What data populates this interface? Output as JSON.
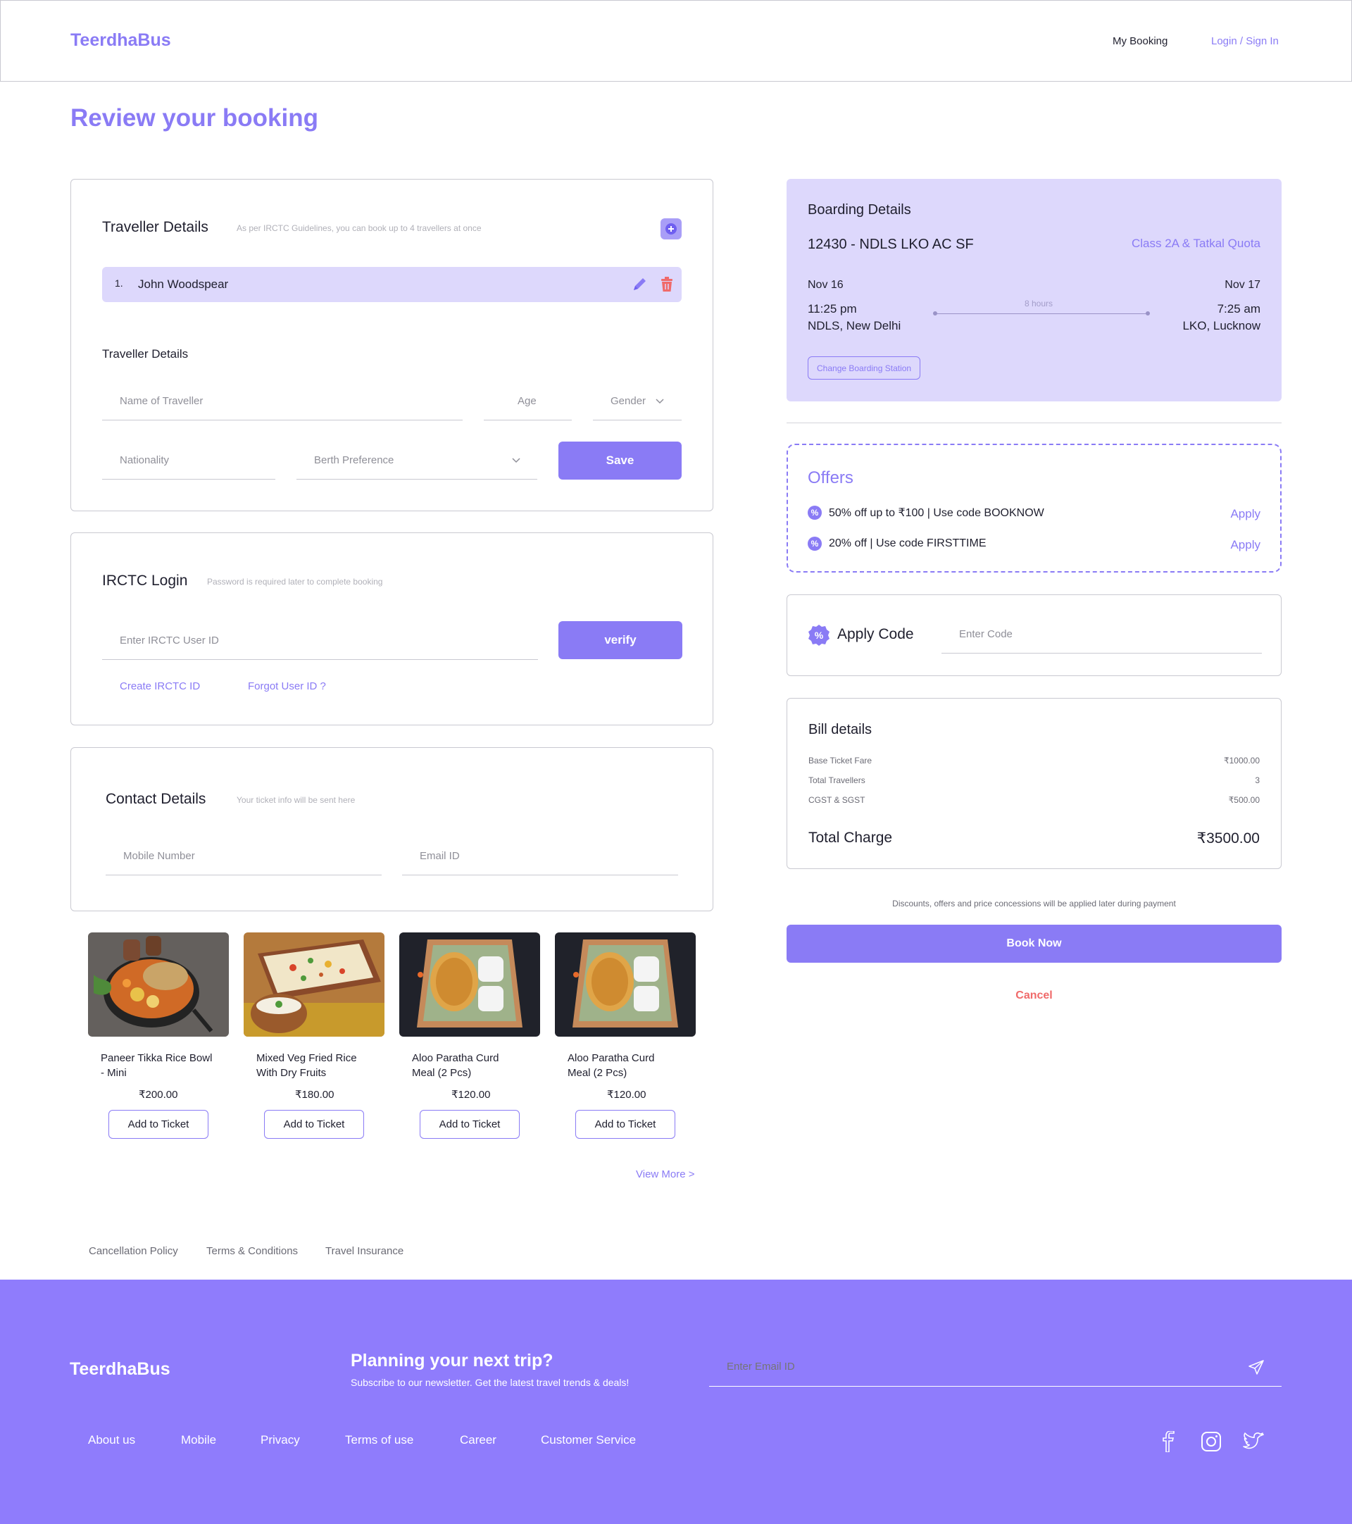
{
  "header": {
    "logo": "TeerdhaBus",
    "my_booking": "My Booking",
    "login": "Login / Sign In"
  },
  "page_title": "Review your booking",
  "traveller": {
    "title": "Traveller Details",
    "hint": "As per IRCTC Guidelines, you can book up to 4 travellers at once",
    "list": [
      {
        "index": "1.",
        "name": "John Woodspear"
      }
    ],
    "form_title": "Traveller Details",
    "name_placeholder": "Name of Traveller",
    "age_placeholder": "Age",
    "gender_label": "Gender",
    "nationality_placeholder": "Nationality",
    "berth_label": "Berth Preference",
    "save_label": "Save"
  },
  "irctc": {
    "title": "IRCTC Login",
    "hint": "Password is required later to complete booking",
    "userid_placeholder": "Enter IRCTC User ID",
    "verify_label": "verify",
    "create_label": "Create IRCTC ID",
    "forgot_label": "Forgot User ID ?"
  },
  "contact": {
    "title": "Contact Details",
    "hint": "Your ticket info will be sent here",
    "mobile_placeholder": "Mobile Number",
    "email_placeholder": "Email ID"
  },
  "food": {
    "items": [
      {
        "name": "Paneer Tikka Rice Bowl - Mini",
        "price": "₹200.00",
        "button": "Add to Ticket"
      },
      {
        "name": "Mixed Veg Fried Rice With Dry Fruits",
        "price": "₹180.00",
        "button": "Add to Ticket"
      },
      {
        "name": "Aloo Paratha Curd Meal (2 Pcs)",
        "price": "₹120.00",
        "button": "Add to Ticket"
      },
      {
        "name": "Aloo Paratha Curd Meal (2 Pcs)",
        "price": "₹120.00",
        "button": "Add to Ticket"
      }
    ],
    "view_more": "View More >"
  },
  "policy_links": [
    "Cancellation Policy",
    "Terms & Conditions",
    "Travel Insurance"
  ],
  "boarding": {
    "title": "Boarding Details",
    "train": "12430 - NDLS LKO AC SF",
    "class_quota": "Class 2A & Tatkal Quota",
    "depart_date": "Nov 16",
    "depart_time": "11:25 pm",
    "depart_station": "NDLS, New Delhi",
    "duration": "8 hours",
    "arrive_date": "Nov 17",
    "arrive_time": "7:25 am",
    "arrive_station": "LKO, Lucknow",
    "change_label": "Change Boarding Station"
  },
  "offers": {
    "title": "Offers",
    "items": [
      {
        "text": "50% off up to ₹100 | Use code BOOKNOW",
        "action": "Apply"
      },
      {
        "text": "20% off | Use code FIRSTTIME",
        "action": "Apply"
      }
    ]
  },
  "apply_code": {
    "label": "Apply Code",
    "placeholder": "Enter Code"
  },
  "bill": {
    "title": "Bill details",
    "rows": [
      {
        "label": "Base Ticket Fare",
        "value": "₹1000.00"
      },
      {
        "label": "Total Travellers",
        "value": "3"
      },
      {
        "label": "CGST & SGST",
        "value": "₹500.00"
      }
    ],
    "total_label": "Total Charge",
    "total_value": "₹3500.00"
  },
  "note": "Discounts, offers and price concessions will be applied later during payment",
  "book_now": "Book Now",
  "cancel": "Cancel",
  "footer": {
    "logo": "TeerdhaBus",
    "newsletter_title": "Planning your next trip?",
    "newsletter_sub": "Subscribe to our newsletter. Get the latest travel trends & deals!",
    "email_placeholder": "Enter Email ID",
    "links": [
      "About us",
      "Mobile",
      "Privacy",
      "Terms of use",
      "Career",
      "Customer Service"
    ]
  },
  "colors": {
    "accent": "#8a7bf5",
    "accent_light": "#ddd8fc",
    "footer_bg": "#8f7cfc",
    "danger": "#f06a6a"
  }
}
